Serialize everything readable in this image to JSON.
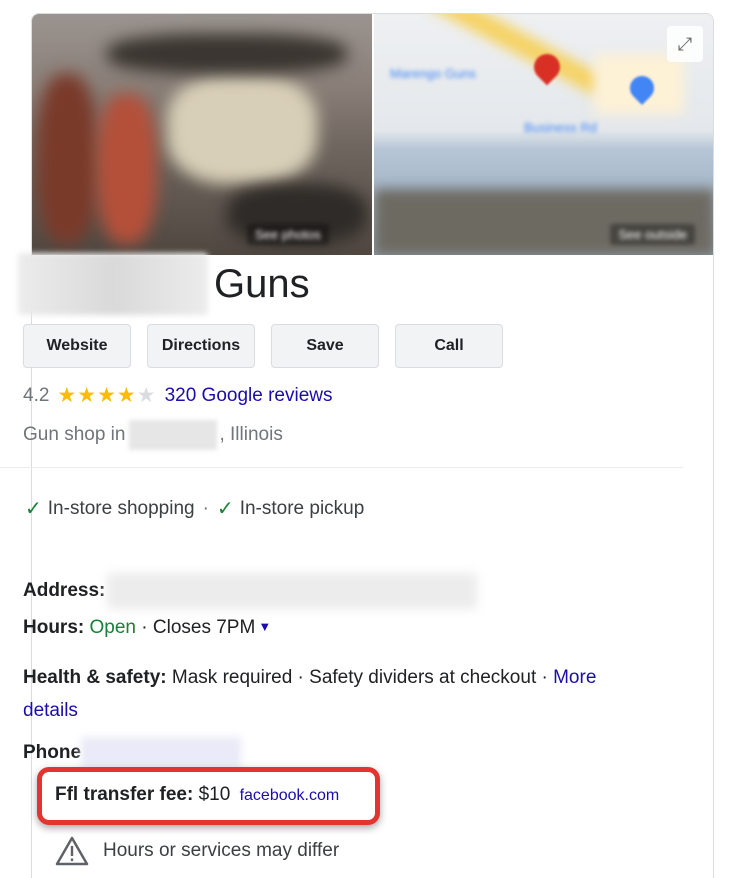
{
  "business": {
    "name_suffix": "Guns",
    "rating": "4.2",
    "stars_filled": "★★★★",
    "stars_empty": "★",
    "rating_value": 4.2,
    "reviews_link": "320 Google reviews",
    "category_prefix": "Gun shop in",
    "category_state": ", Illinois"
  },
  "actions": {
    "website": "Website",
    "directions": "Directions",
    "save": "Save",
    "call": "Call"
  },
  "features": {
    "item1": "In-store shopping",
    "separator": "·",
    "item2": "In-store pickup"
  },
  "info": {
    "address_label": "Address:",
    "hours_label": "Hours:",
    "hours_status": "Open",
    "hours_close": "· Closes 7PM",
    "health_label": "Health & safety:",
    "health_text": "Mask required · Safety dividers at checkout ·",
    "health_more": "More",
    "health_details": "details",
    "phone_label": "Phone",
    "ffl_label": "Ffl transfer fee:",
    "ffl_value": "$10",
    "ffl_source": "facebook.com"
  },
  "warning": {
    "text": "Hours or services may differ"
  },
  "icons": {
    "check": "check-icon",
    "caret": "caret-down-icon",
    "warning": "warning-triangle-icon",
    "expand": "expand-icon"
  },
  "colors": {
    "link": "#1a0dab",
    "open": "#188038",
    "star": "#fbbc04",
    "highlight": "#e3342f"
  }
}
